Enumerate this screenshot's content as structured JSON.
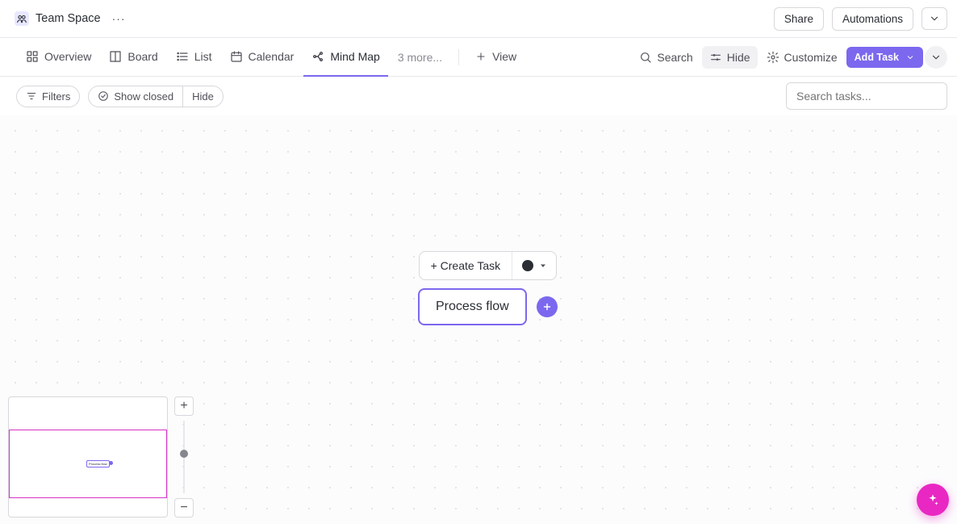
{
  "header": {
    "space_title": "Team Space",
    "share_label": "Share",
    "automations_label": "Automations"
  },
  "tabs": {
    "items": [
      {
        "label": "Overview",
        "icon": "grid"
      },
      {
        "label": "Board",
        "icon": "columns"
      },
      {
        "label": "List",
        "icon": "list"
      },
      {
        "label": "Calendar",
        "icon": "calendar"
      },
      {
        "label": "Mind Map",
        "icon": "mindmap"
      }
    ],
    "active_index": 4,
    "more_label": "3 more...",
    "add_view_label": "View"
  },
  "toolbar": {
    "search_label": "Search",
    "hide_label": "Hide",
    "customize_label": "Customize",
    "add_task_label": "Add Task"
  },
  "filters": {
    "filters_label": "Filters",
    "show_closed_label": "Show closed",
    "hide_label": "Hide",
    "search_placeholder": "Search tasks..."
  },
  "canvas": {
    "create_task_label": "+ Create Task",
    "status_color": "#2a2e34",
    "node_label": "Process flow"
  },
  "overview": {
    "mini_label": "Process flow"
  },
  "colors": {
    "accent": "#7b68ee",
    "fab": "#e927c3",
    "viewport": "#d633c3"
  }
}
